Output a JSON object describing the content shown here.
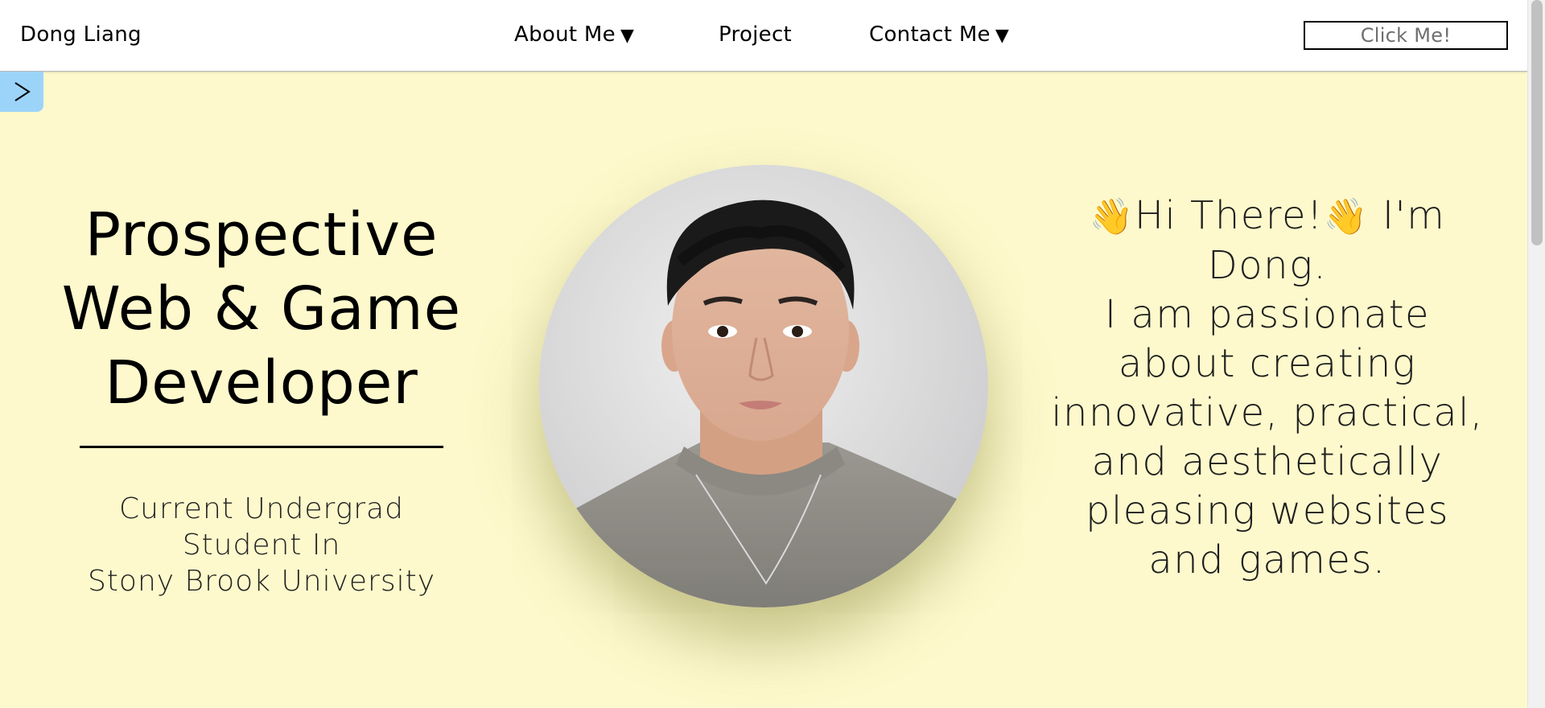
{
  "navbar": {
    "brand": "Dong Liang",
    "items": [
      {
        "label": "About Me",
        "has_dropdown": true
      },
      {
        "label": "Project",
        "has_dropdown": false
      },
      {
        "label": "Contact Me",
        "has_dropdown": true
      }
    ],
    "dropdown_caret": "▼",
    "cta_label": "Click Me!"
  },
  "side_toggle": {
    "icon": "chevron-right-icon",
    "glyph": ">"
  },
  "hero": {
    "title_lines": [
      "Prospective",
      "Web & Game",
      "Developer"
    ],
    "subtitle_lines": [
      "Current Undergrad",
      "Student In",
      "Stony Brook University"
    ],
    "intro": {
      "wave_emoji": "👋",
      "greeting": "Hi There!",
      "name_line": "I'm Dong.",
      "body": "I am passionate about creating innovative, practical, and aesthetically pleasing websites and games."
    },
    "avatar": {
      "icon": "profile-photo"
    }
  },
  "colors": {
    "background": "#fdf9cc",
    "navbar": "#ffffff",
    "toggle": "#9cd4f9",
    "text": "#000000"
  }
}
